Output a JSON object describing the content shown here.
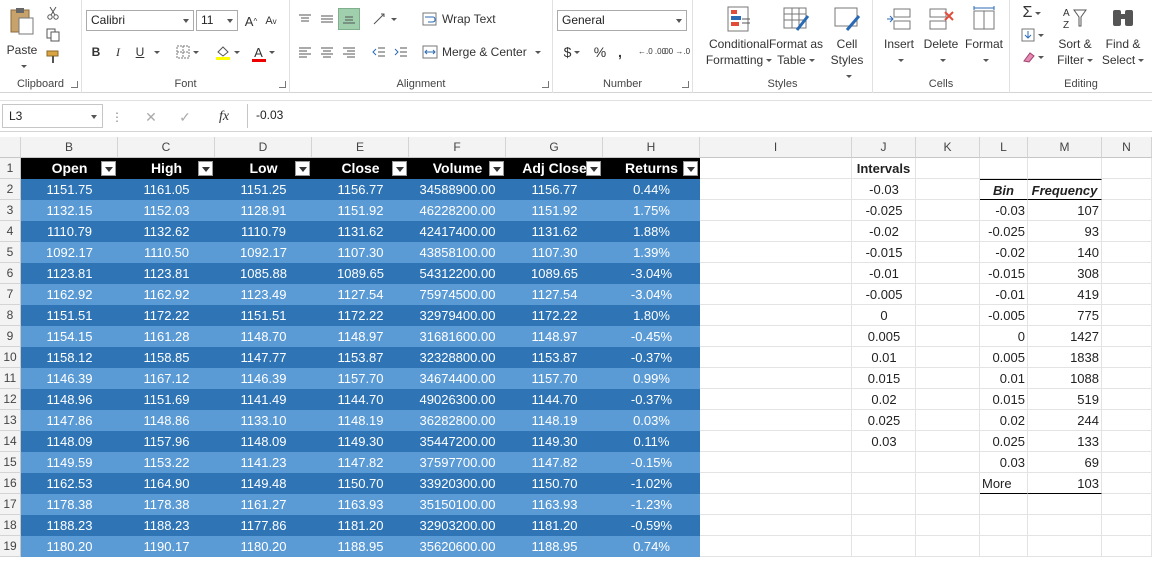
{
  "ribbon": {
    "clipboard": {
      "label": "Clipboard",
      "paste": "Paste"
    },
    "font": {
      "label": "Font",
      "name": "Calibri",
      "size": "11",
      "bold": "B",
      "italic": "I",
      "underline": "U",
      "grow": "A",
      "shrink": "A",
      "font_color_letter": "A"
    },
    "alignment": {
      "label": "Alignment",
      "wrap_text": "Wrap Text",
      "merge_center": "Merge & Center"
    },
    "number": {
      "label": "Number",
      "format": "General",
      "currency": "$",
      "percent": "%",
      "comma": ",",
      "inc_dec": "←.0 .00",
      "dec_dec": ".00 →.0"
    },
    "styles": {
      "label": "Styles",
      "conditional_1": "Conditional",
      "conditional_2": "Formatting",
      "format_table_1": "Format as",
      "format_table_2": "Table",
      "cell_styles_1": "Cell",
      "cell_styles_2": "Styles"
    },
    "cells": {
      "label": "Cells",
      "insert": "Insert",
      "delete": "Delete",
      "format": "Format"
    },
    "editing": {
      "label": "Editing",
      "sort_1": "Sort &",
      "sort_2": "Filter",
      "find_1": "Find &",
      "find_2": "Select"
    }
  },
  "formula_bar": {
    "name_box": "L3",
    "formula": "-0.03",
    "fx": "fx"
  },
  "columns": [
    "B",
    "C",
    "D",
    "E",
    "F",
    "G",
    "H",
    "I",
    "J",
    "K",
    "L",
    "M",
    "N"
  ],
  "table_headers": [
    "Open",
    "High",
    "Low",
    "Close",
    "Volume",
    "Adj Close",
    "Returns"
  ],
  "rows": [
    {
      "num": "1"
    },
    {
      "num": "2",
      "d": [
        "1151.75",
        "1161.05",
        "1151.25",
        "1156.77",
        "34588900.00",
        "1156.77",
        "0.44%"
      ],
      "j": "-0.03",
      "l": "Bin",
      "m": "Frequency"
    },
    {
      "num": "3",
      "d": [
        "1132.15",
        "1152.03",
        "1128.91",
        "1151.92",
        "46228200.00",
        "1151.92",
        "1.75%"
      ],
      "j": "-0.025",
      "l": "-0.03",
      "m": "107"
    },
    {
      "num": "4",
      "d": [
        "1110.79",
        "1132.62",
        "1110.79",
        "1131.62",
        "42417400.00",
        "1131.62",
        "1.88%"
      ],
      "j": "-0.02",
      "l": "-0.025",
      "m": "93"
    },
    {
      "num": "5",
      "d": [
        "1092.17",
        "1110.50",
        "1092.17",
        "1107.30",
        "43858100.00",
        "1107.30",
        "1.39%"
      ],
      "j": "-0.015",
      "l": "-0.02",
      "m": "140"
    },
    {
      "num": "6",
      "d": [
        "1123.81",
        "1123.81",
        "1085.88",
        "1089.65",
        "54312200.00",
        "1089.65",
        "-3.04%"
      ],
      "j": "-0.01",
      "l": "-0.015",
      "m": "308"
    },
    {
      "num": "7",
      "d": [
        "1162.92",
        "1162.92",
        "1123.49",
        "1127.54",
        "75974500.00",
        "1127.54",
        "-3.04%"
      ],
      "j": "-0.005",
      "l": "-0.01",
      "m": "419"
    },
    {
      "num": "8",
      "d": [
        "1151.51",
        "1172.22",
        "1151.51",
        "1172.22",
        "32979400.00",
        "1172.22",
        "1.80%"
      ],
      "j": "0",
      "l": "-0.005",
      "m": "775"
    },
    {
      "num": "9",
      "d": [
        "1154.15",
        "1161.28",
        "1148.70",
        "1148.97",
        "31681600.00",
        "1148.97",
        "-0.45%"
      ],
      "j": "0.005",
      "l": "0",
      "m": "1427"
    },
    {
      "num": "10",
      "d": [
        "1158.12",
        "1158.85",
        "1147.77",
        "1153.87",
        "32328800.00",
        "1153.87",
        "-0.37%"
      ],
      "j": "0.01",
      "l": "0.005",
      "m": "1838"
    },
    {
      "num": "11",
      "d": [
        "1146.39",
        "1167.12",
        "1146.39",
        "1157.70",
        "34674400.00",
        "1157.70",
        "0.99%"
      ],
      "j": "0.015",
      "l": "0.01",
      "m": "1088"
    },
    {
      "num": "12",
      "d": [
        "1148.96",
        "1151.69",
        "1141.49",
        "1144.70",
        "49026300.00",
        "1144.70",
        "-0.37%"
      ],
      "j": "0.02",
      "l": "0.015",
      "m": "519"
    },
    {
      "num": "13",
      "d": [
        "1147.86",
        "1148.86",
        "1133.10",
        "1148.19",
        "36282800.00",
        "1148.19",
        "0.03%"
      ],
      "j": "0.025",
      "l": "0.02",
      "m": "244"
    },
    {
      "num": "14",
      "d": [
        "1148.09",
        "1157.96",
        "1148.09",
        "1149.30",
        "35447200.00",
        "1149.30",
        "0.11%"
      ],
      "j": "0.03",
      "l": "0.025",
      "m": "133"
    },
    {
      "num": "15",
      "d": [
        "1149.59",
        "1153.22",
        "1141.23",
        "1147.82",
        "37597700.00",
        "1147.82",
        "-0.15%"
      ],
      "j": "",
      "l": "0.03",
      "m": "69"
    },
    {
      "num": "16",
      "d": [
        "1162.53",
        "1164.90",
        "1149.48",
        "1150.70",
        "33920300.00",
        "1150.70",
        "-1.02%"
      ],
      "j": "",
      "l": "More",
      "m": "103"
    },
    {
      "num": "17",
      "d": [
        "1178.38",
        "1178.38",
        "1161.27",
        "1163.93",
        "35150100.00",
        "1163.93",
        "-1.23%"
      ],
      "j": "",
      "l": "",
      "m": ""
    },
    {
      "num": "18",
      "d": [
        "1188.23",
        "1188.23",
        "1177.86",
        "1181.20",
        "32903200.00",
        "1181.20",
        "-0.59%"
      ],
      "j": "",
      "l": "",
      "m": ""
    },
    {
      "num": "19",
      "d": [
        "1180.20",
        "1190.17",
        "1180.20",
        "1188.95",
        "35620600.00",
        "1188.95",
        "0.74%"
      ],
      "j": "",
      "l": "",
      "m": ""
    }
  ],
  "j1_label": "Intervals",
  "colors": {
    "band_dark": "#2f75b5",
    "band_light": "#5b9bd5",
    "header_black": "#000000",
    "accent": "#217346"
  }
}
